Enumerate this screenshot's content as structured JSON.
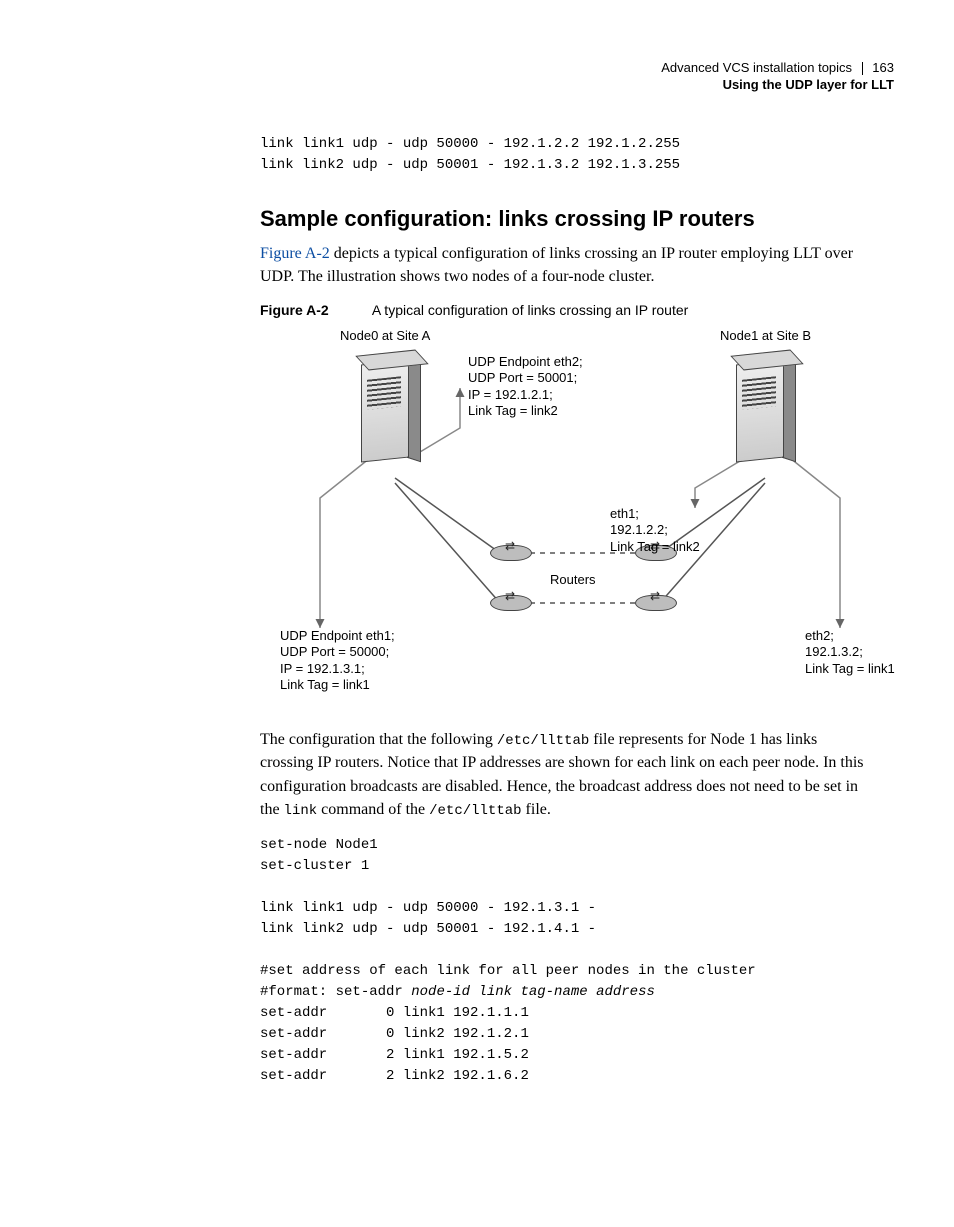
{
  "header": {
    "section_title": "Advanced VCS installation topics",
    "page_number": "163",
    "subsection": "Using the UDP layer for LLT"
  },
  "code_intro": "link link1 udp - udp 50000 - 192.1.2.2 192.1.2.255\nlink link2 udp - udp 50001 - 192.1.3.2 192.1.3.255",
  "section_heading": "Sample configuration: links crossing IP routers",
  "para1_link": "Figure A-2",
  "para1_rest": " depicts a typical configuration of links crossing an IP router employing LLT over UDP. The illustration shows two nodes of a four-node cluster.",
  "figure": {
    "label": "Figure A-2",
    "caption": "A typical configuration of links crossing an IP router",
    "node0_title": "Node0 at Site A",
    "node1_title": "Node1 at Site B",
    "routers_label": "Routers",
    "node0_eth2": "UDP Endpoint eth2;\nUDP Port = 50001;\nIP = 192.1.2.1;\nLink Tag = link2",
    "node0_eth1": "UDP Endpoint eth1;\nUDP Port = 50000;\nIP = 192.1.3.1;\nLink Tag = link1",
    "node1_eth1": "eth1;\n192.1.2.2;\nLink Tag = link2",
    "node1_eth2": "eth2;\n192.1.3.2;\nLink Tag = link1"
  },
  "para2_a": "The configuration that the following ",
  "para2_mono1": "/etc/llttab",
  "para2_b": " file represents for Node 1 has links crossing IP routers. Notice that IP addresses are shown for each link on each peer node. In this configuration broadcasts are disabled. Hence, the broadcast address does not need to be set in the ",
  "para2_mono2": "link",
  "para2_c": " command of the ",
  "para2_mono3": "/etc/llttab",
  "para2_d": " file.",
  "code2": {
    "l1": "set-node Node1",
    "l2": "set-cluster 1",
    "l3": "",
    "l4": "link link1 udp - udp 50000 - 192.1.3.1 -",
    "l5": "link link2 udp - udp 50001 - 192.1.4.1 -",
    "l6": "",
    "l7": "#set address of each link for all peer nodes in the cluster",
    "l8a": "#format: set-addr ",
    "l8b": "node-id link tag-name address",
    "l9": "set-addr       0 link1 192.1.1.1",
    "l10": "set-addr       0 link2 192.1.2.1",
    "l11": "set-addr       2 link1 192.1.5.2",
    "l12": "set-addr       2 link2 192.1.6.2"
  }
}
